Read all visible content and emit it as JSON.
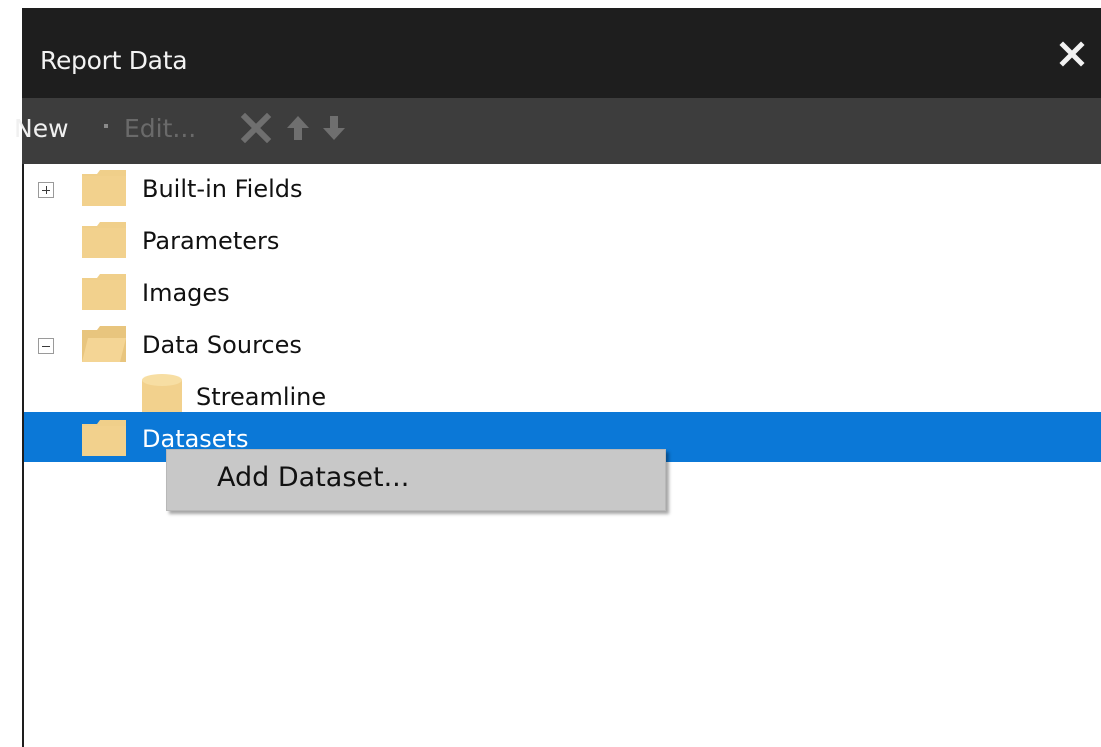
{
  "window": {
    "title": "Report Data",
    "close_icon": "close-icon"
  },
  "toolbar": {
    "new_label": "New",
    "edit_label": "Edit...",
    "delete_icon": "delete-icon",
    "move_up_icon": "arrow-up-icon",
    "move_down_icon": "arrow-down-icon"
  },
  "tree": {
    "items": [
      {
        "label": "Built-in Fields",
        "expander": "+",
        "icon": "folder-icon"
      },
      {
        "label": "Parameters",
        "icon": "folder-icon"
      },
      {
        "label": "Images",
        "icon": "folder-icon"
      },
      {
        "label": "Data Sources",
        "expander": "-",
        "icon": "folder-open-icon"
      },
      {
        "label": "Streamline",
        "icon": "database-icon"
      },
      {
        "label": "Datasets",
        "icon": "folder-icon",
        "selected": true
      }
    ]
  },
  "context_menu": {
    "items": [
      {
        "label": "Add Dataset..."
      }
    ]
  },
  "colors": {
    "titlebar": "#1e1e1e",
    "toolbar": "#3d3d3d",
    "selection": "#0b78d7",
    "folder": "#f0cf8a",
    "menu_bg": "#c8c8c8"
  }
}
